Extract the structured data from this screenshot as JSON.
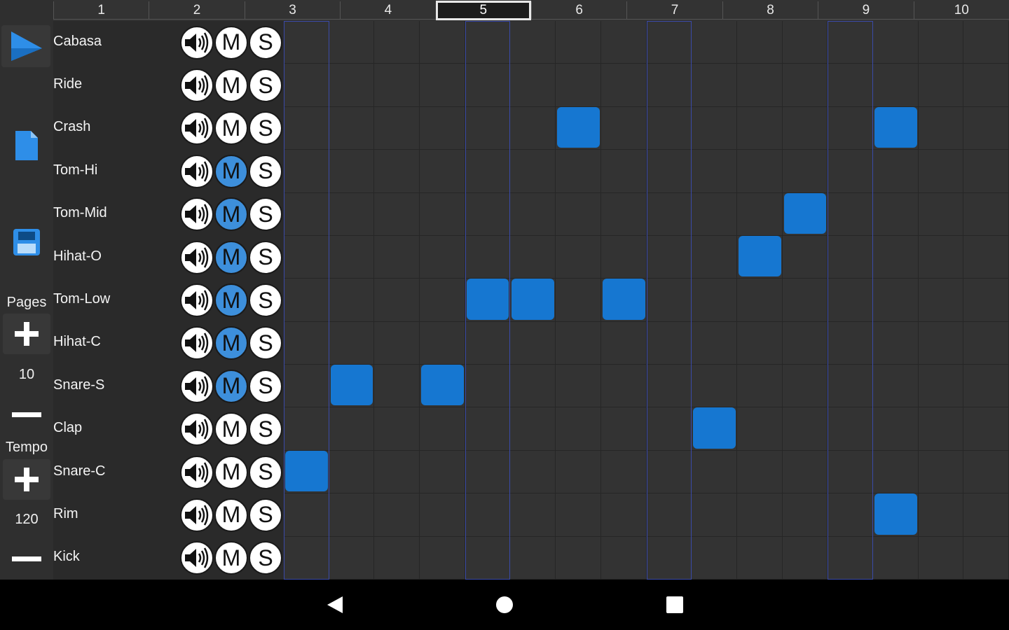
{
  "colors": {
    "accent": "#1677d1",
    "mute_active": "#3d8fdb",
    "beat_outline": "#3a4aa8"
  },
  "pages": {
    "labels": [
      "1",
      "2",
      "3",
      "4",
      "5",
      "6",
      "7",
      "8",
      "9",
      "10"
    ],
    "current": 5
  },
  "left_panel": {
    "play_icon": "play-icon",
    "new_icon": "document-icon",
    "save_icon": "save-icon",
    "pages_label": "Pages",
    "pages_value": "10",
    "tempo_label": "Tempo",
    "tempo_value": "120",
    "plus_icon": "plus-icon",
    "minus_icon": "minus-icon"
  },
  "track_buttons": {
    "volume_icon": "speaker-icon",
    "mute_label": "M",
    "solo_label": "S"
  },
  "tracks": [
    {
      "name": "Cabasa",
      "muted": false
    },
    {
      "name": "Ride",
      "muted": false
    },
    {
      "name": "Crash",
      "muted": false
    },
    {
      "name": "Tom-Hi",
      "muted": true
    },
    {
      "name": "Tom-Mid",
      "muted": true
    },
    {
      "name": "Hihat-O",
      "muted": true
    },
    {
      "name": "Tom-Low",
      "muted": true
    },
    {
      "name": "Hihat-C",
      "muted": true
    },
    {
      "name": "Snare-S",
      "muted": true
    },
    {
      "name": "Clap",
      "muted": false
    },
    {
      "name": "Snare-C",
      "muted": false
    },
    {
      "name": "Rim",
      "muted": false
    },
    {
      "name": "Kick",
      "muted": false
    }
  ],
  "grid": {
    "steps": 16,
    "highlighted_steps": [
      0,
      4,
      8,
      12
    ],
    "active": [
      {
        "track": 2,
        "step": 6
      },
      {
        "track": 2,
        "step": 13
      },
      {
        "track": 4,
        "step": 11
      },
      {
        "track": 5,
        "step": 10
      },
      {
        "track": 6,
        "step": 4
      },
      {
        "track": 6,
        "step": 5
      },
      {
        "track": 6,
        "step": 7
      },
      {
        "track": 8,
        "step": 1
      },
      {
        "track": 8,
        "step": 3
      },
      {
        "track": 9,
        "step": 9
      },
      {
        "track": 10,
        "step": 0
      },
      {
        "track": 11,
        "step": 13
      }
    ]
  },
  "navbar": {
    "back_icon": "back-triangle-icon",
    "home_icon": "home-circle-icon",
    "recents_icon": "recents-square-icon"
  }
}
